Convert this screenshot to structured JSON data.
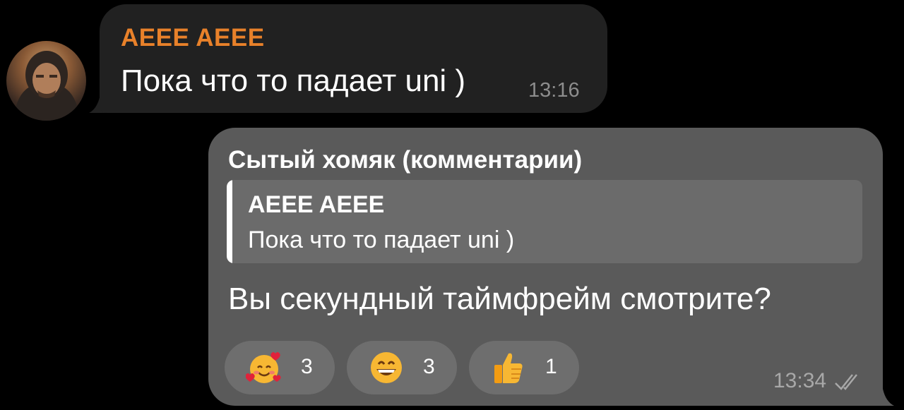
{
  "incoming": {
    "sender": "AEEE AEEE",
    "text": "Пока что то падает uni )",
    "time": "13:16",
    "sender_color": "#e8812a"
  },
  "outgoing": {
    "sender": "Сытый хомяк (комментарии)",
    "reply": {
      "sender": "AEEE AEEE",
      "text": "Пока что то падает uni )"
    },
    "text": "Вы секундный таймфрейм смотрите?",
    "time": "13:34",
    "status_icon": "double-check-icon",
    "reactions": [
      {
        "emoji": "smiling-face-with-hearts-icon",
        "count": "3"
      },
      {
        "emoji": "grinning-face-icon",
        "count": "3"
      },
      {
        "emoji": "thumbs-up-icon",
        "count": "1"
      }
    ]
  },
  "colors": {
    "background": "#000000",
    "incoming_bubble": "#212121",
    "outgoing_bubble": "#5a5a5a",
    "reaction_pill": "#6e6e6e"
  }
}
